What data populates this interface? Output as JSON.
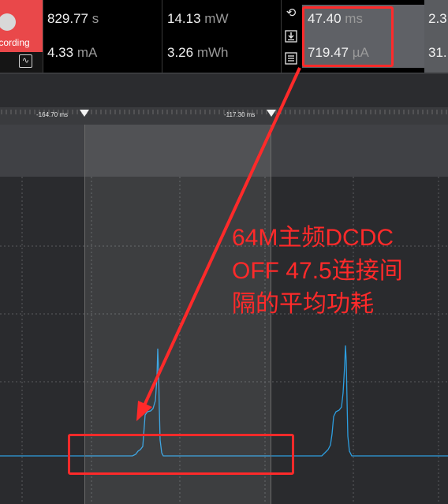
{
  "recording": {
    "label": "Recording",
    "mode_icon": "waveform-icon"
  },
  "stats": {
    "time_value": "829.77",
    "time_unit": "s",
    "current_value": "4.33",
    "current_unit": "mA",
    "power_value": "14.13",
    "power_unit": "mW",
    "energy_value": "3.26",
    "energy_unit": "mWh"
  },
  "selection_stats": {
    "duration_value": "47.40",
    "duration_unit": "ms",
    "avg_current_value": "719.47",
    "avg_current_unit": "µA",
    "partial_top": "2.3",
    "partial_bottom": "31."
  },
  "toolbar_icons": [
    "reset-icon",
    "download-icon",
    "list-icon"
  ],
  "ruler": {
    "marker_left": "-164.70 ms",
    "marker_right": "-117.30 ms"
  },
  "annotation": {
    "line1": "64M主频DCDC",
    "line2": "OFF 47.5连接间",
    "line3": "隔的平均功耗"
  },
  "colors": {
    "record_red": "#e9484a",
    "trace_blue": "#2d9ee0",
    "annotation_red": "#ff2a2a"
  }
}
